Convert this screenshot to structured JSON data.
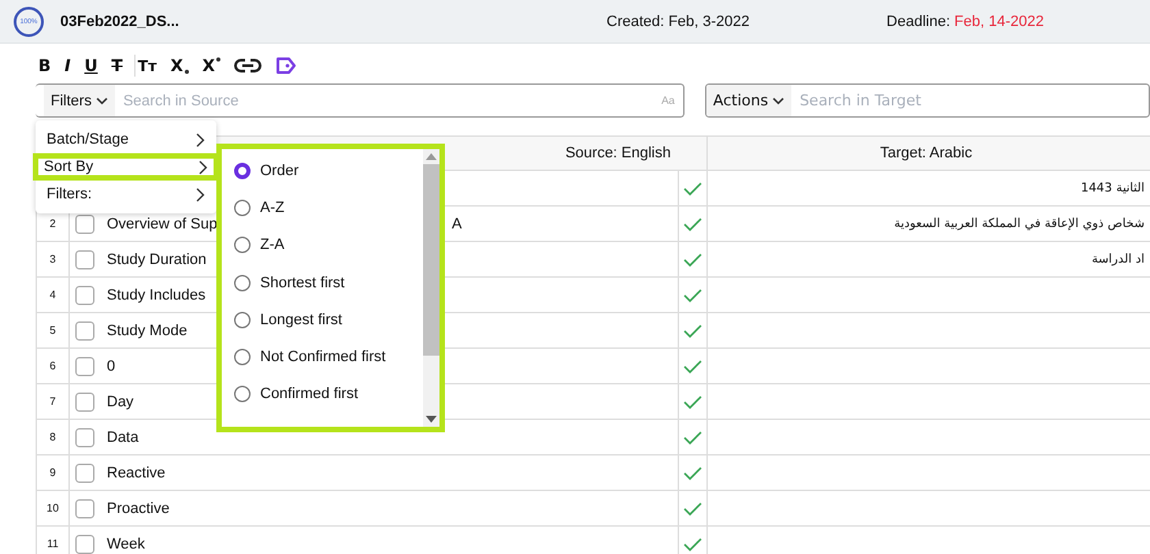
{
  "header": {
    "progress": "100%",
    "title": "03Feb2022_DS...",
    "created_label": "Created:",
    "created": "Feb, 3-2022",
    "deadline_label": "Deadline:",
    "deadline": "Feb, 14-2022"
  },
  "toolbar": [
    {
      "kind": "bold",
      "label": "B"
    },
    {
      "kind": "italic",
      "label": "I"
    },
    {
      "kind": "underline",
      "label": "U"
    },
    {
      "kind": "strike",
      "label": "T"
    },
    {
      "kind": "case",
      "label": "Tт"
    },
    {
      "kind": "sub",
      "label": "X"
    },
    {
      "kind": "sup",
      "label": "X"
    },
    {
      "kind": "link"
    },
    {
      "kind": "tag"
    }
  ],
  "source_search": {
    "menu": "Filters",
    "placeholder": "Search in Source",
    "case_toggle": "Aa"
  },
  "target_search": {
    "menu": "Actions",
    "placeholder": "Search in Target"
  },
  "table": {
    "columns": [
      "Source: English",
      "Target: Arabic"
    ],
    "rows": [
      {
        "confirmed": true,
        "target": "الثانية 1443"
      },
      {
        "number": "2",
        "checked": false,
        "source": "Overview of Sup",
        "source_tail": "A",
        "confirmed": true,
        "target": "شخاص ذوي الإعاقة في المملكة العربية السعودية"
      },
      {
        "number": "3",
        "checked": false,
        "source": "Study Duration",
        "confirmed": true,
        "target": "اد الدراسة"
      },
      {
        "number": "4",
        "checked": false,
        "source": "Study Includes",
        "confirmed": true
      },
      {
        "number": "5",
        "checked": false,
        "source": "Study Mode",
        "confirmed": true
      },
      {
        "number": "6",
        "checked": false,
        "source": "0",
        "confirmed": true
      },
      {
        "number": "7",
        "checked": false,
        "source": "Day",
        "confirmed": true
      },
      {
        "number": "8",
        "checked": false,
        "source": "Data",
        "confirmed": true
      },
      {
        "number": "9",
        "checked": false,
        "source": "Reactive",
        "confirmed": true
      },
      {
        "number": "10",
        "checked": false,
        "source": "Proactive",
        "confirmed": true
      },
      {
        "number": "11",
        "checked": false,
        "source": "Week",
        "confirmed": true
      }
    ]
  },
  "filters_menu": {
    "items": [
      {
        "label": "Batch/Stage",
        "selected": false
      },
      {
        "label": "Sort By",
        "selected": true
      },
      {
        "label": "Filters:",
        "selected": false
      }
    ]
  },
  "sort_menu": {
    "options": [
      {
        "label": "Order",
        "selected": true
      },
      {
        "label": "A-Z",
        "selected": false
      },
      {
        "label": "Z-A",
        "selected": false
      },
      {
        "label": "Shortest first",
        "selected": false
      },
      {
        "label": "Longest first",
        "selected": false
      },
      {
        "label": "Not Confirmed first",
        "selected": false
      },
      {
        "label": "Confirmed first",
        "selected": false
      }
    ]
  }
}
